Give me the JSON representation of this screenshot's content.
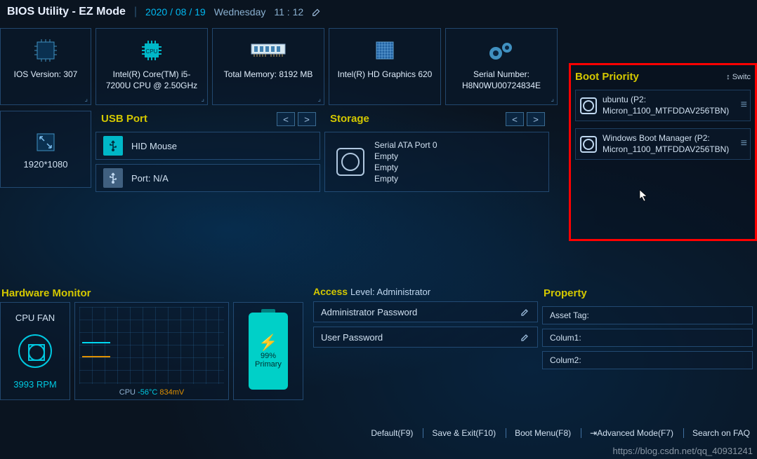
{
  "header": {
    "title": "BIOS Utility - EZ Mode",
    "date": "2020 / 08 / 19",
    "day": "Wednesday",
    "time": "11 : 12"
  },
  "info": {
    "bios_version_label": "IOS Version: 307",
    "cpu": "Intel(R) Core(TM) i5-7200U CPU @ 2.50GHz",
    "memory": "Total Memory:  8192 MB",
    "gpu": "Intel(R) HD Graphics 620",
    "serial_label": "Serial Number:",
    "serial": "H8N0WU00724834E"
  },
  "resolution": "1920*1080",
  "usb": {
    "title": "USB Port",
    "item1": "HID Mouse",
    "item2": "Port: N/A"
  },
  "storage": {
    "title": "Storage",
    "port": "Serial ATA Port 0",
    "l1": "Empty",
    "l2": "Empty",
    "l3": "Empty"
  },
  "boot": {
    "title": "Boot Priority",
    "switch": "Switc",
    "items": [
      {
        "name": "ubuntu (P2:",
        "sub": "Micron_1100_MTFDDAV256TBN)"
      },
      {
        "name": "Windows Boot Manager (P2:",
        "sub": "Micron_1100_MTFDDAV256TBN)"
      }
    ]
  },
  "hw": {
    "title": "Hardware Monitor",
    "fan_label": "CPU FAN",
    "fan_rpm": "3993 RPM",
    "cpu_label": "CPU",
    "temp": "-56°C",
    "volt": "834mV",
    "battery_pct": "99%",
    "battery_state": "Primary"
  },
  "access": {
    "title": "Access",
    "level_label": "Level: Administrator",
    "admin_pw": "Administrator Password",
    "user_pw": "User Password"
  },
  "property": {
    "title": "Property",
    "r1": "Asset Tag:",
    "r2": "Colum1:",
    "r3": "Colum2:"
  },
  "footer": {
    "f1": "Default(F9)",
    "f2": "Save & Exit(F10)",
    "f3": "Boot Menu(F8)",
    "f4": "Advanced Mode(F7)",
    "f5": "Search on FAQ"
  },
  "watermark": "https://blog.csdn.net/qq_40931241"
}
